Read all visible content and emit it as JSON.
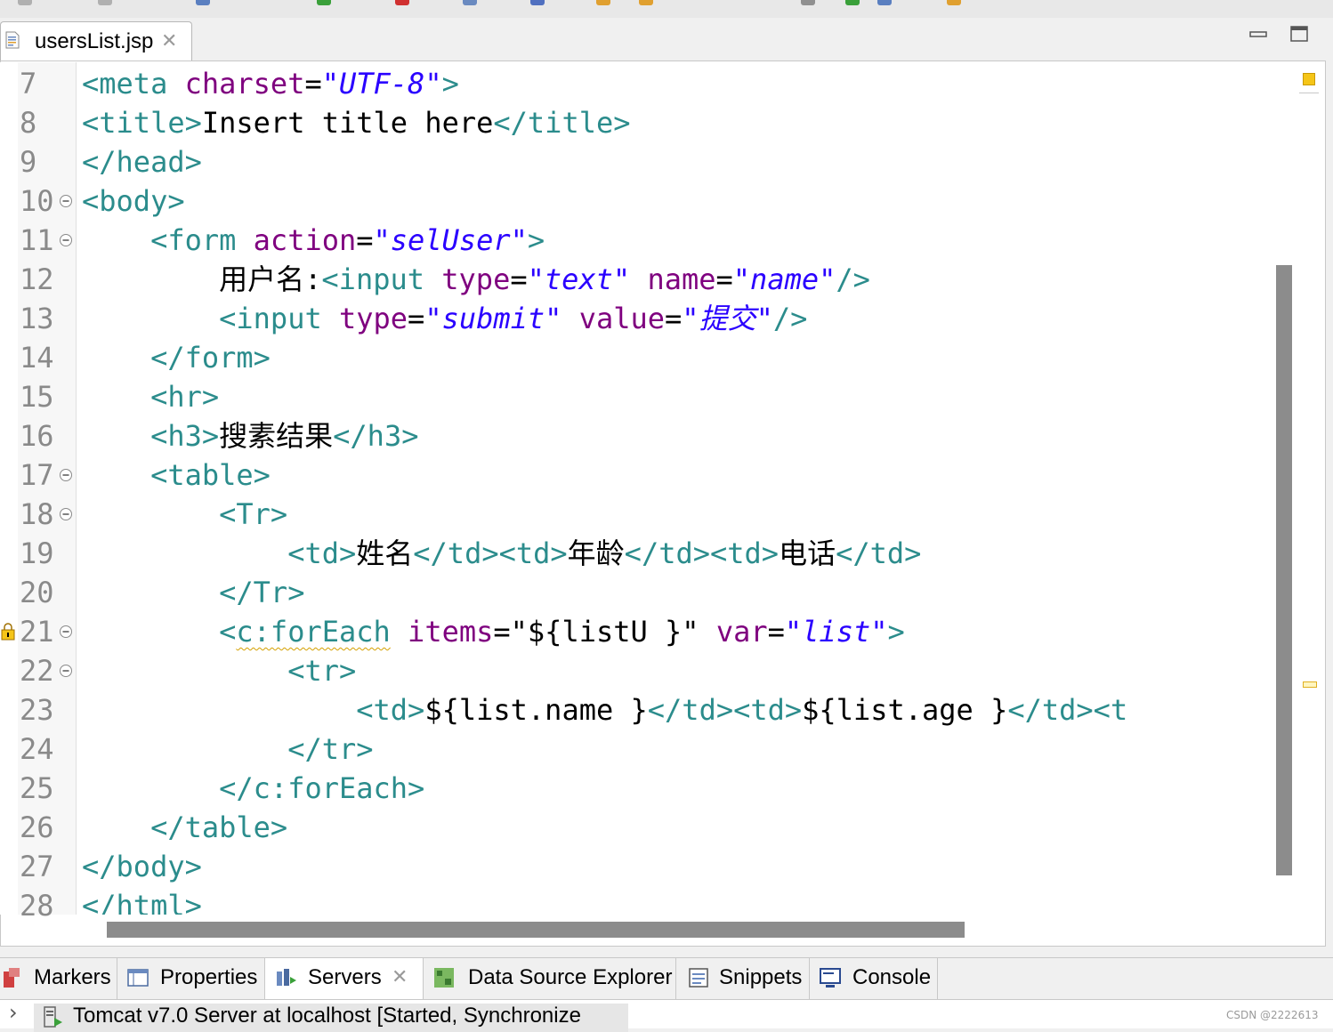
{
  "editor": {
    "tab_title": "usersList.jsp",
    "lines": [
      {
        "num": "7",
        "tokens": [
          [
            "tag",
            "<meta "
          ],
          [
            "attr",
            "charset"
          ],
          [
            "plain",
            "="
          ],
          [
            "val",
            "\"UTF-8\""
          ],
          [
            "tag",
            ">"
          ]
        ]
      },
      {
        "num": "8",
        "tokens": [
          [
            "tag",
            "<title>"
          ],
          [
            "plain",
            "Insert title here"
          ],
          [
            "tag",
            "</title>"
          ]
        ]
      },
      {
        "num": "9",
        "tokens": [
          [
            "tag",
            "</head>"
          ]
        ]
      },
      {
        "num": "10",
        "fold": true,
        "tokens": [
          [
            "tag",
            "<body>"
          ]
        ]
      },
      {
        "num": "11",
        "fold": true,
        "tokens": [
          [
            "plain",
            "    "
          ],
          [
            "tag",
            "<form "
          ],
          [
            "attr",
            "action"
          ],
          [
            "plain",
            "="
          ],
          [
            "val",
            "\"selUser\""
          ],
          [
            "tag",
            ">"
          ]
        ]
      },
      {
        "num": "12",
        "tokens": [
          [
            "plain",
            "        用户名:"
          ],
          [
            "tag",
            "<input "
          ],
          [
            "attr",
            "type"
          ],
          [
            "plain",
            "="
          ],
          [
            "val",
            "\"text\" "
          ],
          [
            "attr",
            "name"
          ],
          [
            "plain",
            "="
          ],
          [
            "val",
            "\"name\""
          ],
          [
            "tag",
            "/>"
          ]
        ]
      },
      {
        "num": "13",
        "tokens": [
          [
            "plain",
            "        "
          ],
          [
            "tag",
            "<input "
          ],
          [
            "attr",
            "type"
          ],
          [
            "plain",
            "="
          ],
          [
            "val",
            "\"submit\" "
          ],
          [
            "attr",
            "value"
          ],
          [
            "plain",
            "="
          ],
          [
            "val",
            "\"提交\""
          ],
          [
            "tag",
            "/>"
          ]
        ]
      },
      {
        "num": "14",
        "tokens": [
          [
            "plain",
            "    "
          ],
          [
            "tag",
            "</form>"
          ]
        ]
      },
      {
        "num": "15",
        "tokens": [
          [
            "plain",
            "    "
          ],
          [
            "tag",
            "<hr>"
          ]
        ]
      },
      {
        "num": "16",
        "tokens": [
          [
            "plain",
            "    "
          ],
          [
            "tag",
            "<h3>"
          ],
          [
            "plain",
            "搜素结果"
          ],
          [
            "tag",
            "</h3>"
          ]
        ]
      },
      {
        "num": "17",
        "fold": true,
        "tokens": [
          [
            "plain",
            "    "
          ],
          [
            "tag",
            "<table>"
          ]
        ]
      },
      {
        "num": "18",
        "fold": true,
        "tokens": [
          [
            "plain",
            "        "
          ],
          [
            "tag",
            "<Tr>"
          ]
        ]
      },
      {
        "num": "19",
        "tokens": [
          [
            "plain",
            "            "
          ],
          [
            "tag",
            "<td>"
          ],
          [
            "plain",
            "姓名"
          ],
          [
            "tag",
            "</td><td>"
          ],
          [
            "plain",
            "年龄"
          ],
          [
            "tag",
            "</td><td>"
          ],
          [
            "plain",
            "电话"
          ],
          [
            "tag",
            "</td>"
          ]
        ]
      },
      {
        "num": "20",
        "tokens": [
          [
            "plain",
            "        "
          ],
          [
            "tag",
            "</Tr>"
          ]
        ]
      },
      {
        "num": "21",
        "fold": true,
        "warn": true,
        "tokens": [
          [
            "plain",
            "        "
          ],
          [
            "tag",
            "<"
          ],
          [
            "tagsq",
            "c:forEach"
          ],
          [
            "tag",
            " "
          ],
          [
            "attr",
            "items"
          ],
          [
            "plain",
            "=\"${listU }\" "
          ],
          [
            "attr",
            "var"
          ],
          [
            "plain",
            "="
          ],
          [
            "val",
            "\"list\""
          ],
          [
            "tag",
            ">"
          ]
        ]
      },
      {
        "num": "22",
        "fold": true,
        "tokens": [
          [
            "plain",
            "            "
          ],
          [
            "tag",
            "<tr>"
          ]
        ]
      },
      {
        "num": "23",
        "tokens": [
          [
            "plain",
            "                "
          ],
          [
            "tag",
            "<td>"
          ],
          [
            "plain",
            "${list.name }"
          ],
          [
            "tag",
            "</td><td>"
          ],
          [
            "plain",
            "${list.age }"
          ],
          [
            "tag",
            "</td><t"
          ]
        ]
      },
      {
        "num": "24",
        "tokens": [
          [
            "plain",
            "            "
          ],
          [
            "tag",
            "</tr>"
          ]
        ]
      },
      {
        "num": "25",
        "tokens": [
          [
            "plain",
            "        "
          ],
          [
            "tag",
            "</c:forEach>"
          ]
        ]
      },
      {
        "num": "26",
        "tokens": [
          [
            "plain",
            "    "
          ],
          [
            "tag",
            "</table>"
          ]
        ]
      },
      {
        "num": "27",
        "tokens": [
          [
            "tag",
            "</body>"
          ]
        ]
      },
      {
        "num": "28",
        "tokens": [
          [
            "tag",
            "</html>"
          ]
        ]
      }
    ]
  },
  "bottom_panel": {
    "tabs": [
      "Markers",
      "Properties",
      "Servers",
      "Data Source Explorer",
      "Snippets",
      "Console"
    ],
    "active_tab": "Servers",
    "server_entry": "Tomcat v7.0 Server at localhost  [Started, Synchronize"
  },
  "watermark": "CSDN @2222613",
  "colors": {
    "tag": "#2b8c8c",
    "attr": "#7f007f",
    "value": "#2a00ff",
    "line_number": "#8a8a8a",
    "scrollbar": "#8c8c8c"
  }
}
